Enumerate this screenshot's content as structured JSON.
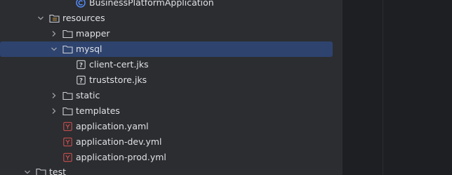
{
  "tree": {
    "items": [
      {
        "label": "BusinessPlatformApplication"
      },
      {
        "label": "resources"
      },
      {
        "label": "mapper"
      },
      {
        "label": "mysql"
      },
      {
        "label": "client-cert.jks"
      },
      {
        "label": "truststore.jks"
      },
      {
        "label": "static"
      },
      {
        "label": "templates"
      },
      {
        "label": "application.yaml"
      },
      {
        "label": "application-dev.yml"
      },
      {
        "label": "application-prod.yml"
      },
      {
        "label": "test"
      }
    ]
  },
  "colors": {
    "background": "#2b2d30",
    "selection": "#2e436e",
    "text": "#dfe1e5",
    "yaml_icon": "#c94f4f",
    "class_icon": "#548af7"
  }
}
